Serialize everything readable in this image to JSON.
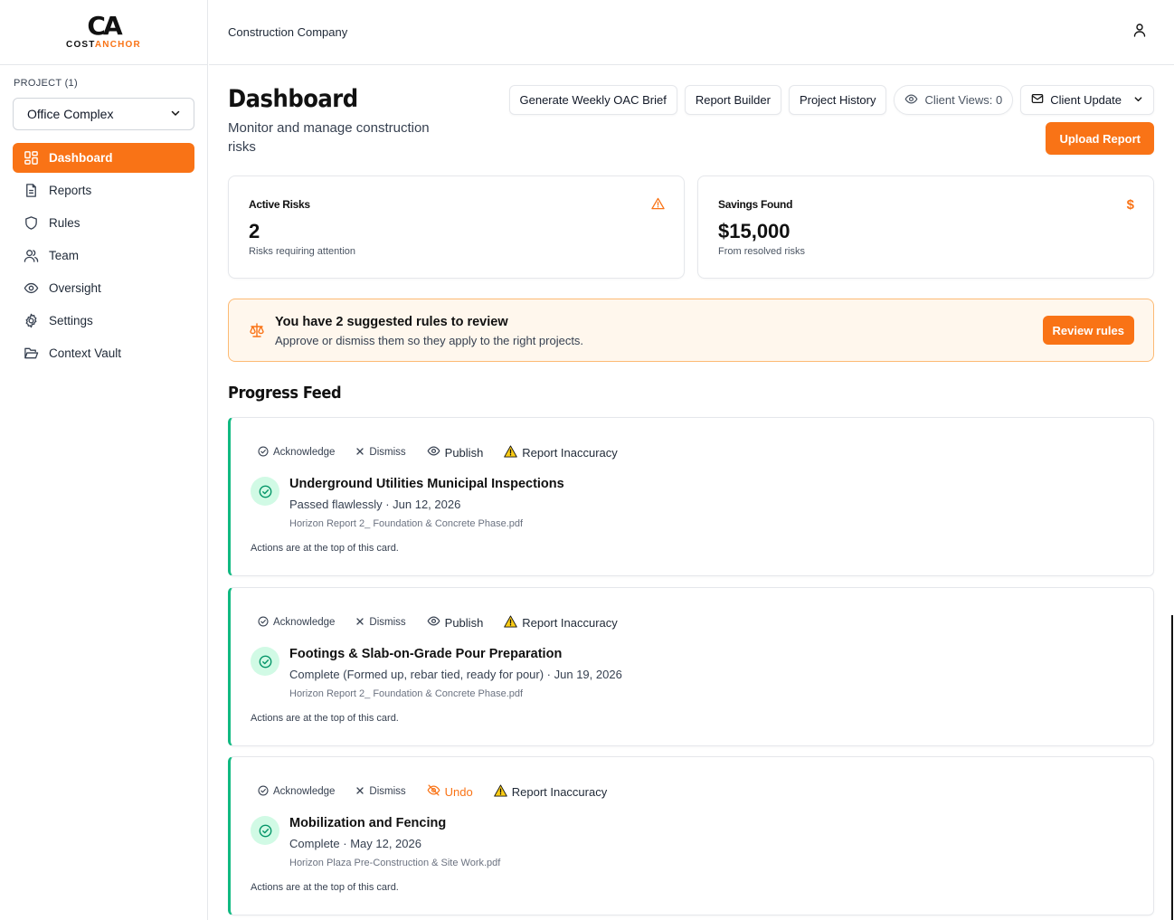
{
  "brand": {
    "mark": "CA",
    "name_part1": "COST",
    "name_part2": "ANCHOR"
  },
  "header": {
    "company": "Construction Company"
  },
  "sidebar": {
    "project_label": "PROJECT (1)",
    "project_selected": "Office Complex",
    "items": [
      {
        "label": "Dashboard",
        "icon": "layout-grid-icon",
        "active": true
      },
      {
        "label": "Reports",
        "icon": "file-text-icon"
      },
      {
        "label": "Rules",
        "icon": "shield-icon"
      },
      {
        "label": "Team",
        "icon": "users-icon"
      },
      {
        "label": "Oversight",
        "icon": "eye-icon"
      },
      {
        "label": "Settings",
        "icon": "gear-icon"
      },
      {
        "label": "Context Vault",
        "icon": "folder-open-icon"
      }
    ]
  },
  "page": {
    "title": "Dashboard",
    "subtitle": "Monitor and manage construction risks"
  },
  "toolbar": {
    "weekly_brief": "Generate Weekly OAC Brief",
    "report_builder": "Report Builder",
    "project_history": "Project History",
    "client_views": "Client Views: 0",
    "client_update": "Client Update",
    "upload_report": "Upload Report"
  },
  "stats": {
    "active_risks": {
      "label": "Active Risks",
      "value": "2",
      "desc": "Risks requiring attention"
    },
    "savings": {
      "label": "Savings Found",
      "value": "$15,000",
      "desc": "From resolved risks",
      "icon_char": "$"
    }
  },
  "banner": {
    "title": "You have 2 suggested rules to review",
    "desc": "Approve or dismiss them so they apply to the right projects.",
    "button": "Review rules"
  },
  "feed": {
    "title": "Progress Feed",
    "action_labels": {
      "acknowledge": "Acknowledge",
      "dismiss": "Dismiss",
      "publish": "Publish",
      "undo": "Undo",
      "report_inaccuracy": "Report Inaccuracy"
    },
    "footer": "Actions are at the top of this card.",
    "cards": [
      {
        "title": "Underground Utilities Municipal Inspections",
        "sub": "Passed flawlessly · Jun 12, 2026",
        "file": "Horizon Report 2_ Foundation & Concrete Phase.pdf",
        "published": false
      },
      {
        "title": "Footings & Slab-on-Grade Pour Preparation",
        "sub": "Complete (Formed up, rebar tied, ready for pour) · Jun 19, 2026",
        "file": "Horizon Report 2_ Foundation & Concrete Phase.pdf",
        "published": false
      },
      {
        "title": "Mobilization and Fencing",
        "sub": "Complete · May 12, 2026",
        "file": "Horizon Plaza Pre-Construction & Site Work.pdf",
        "published": true
      }
    ]
  },
  "colors": {
    "accent": "#f97316",
    "success": "#10b981",
    "success_bg": "#d1fae5",
    "banner_bg": "#fff7ed",
    "banner_border": "#fdba74"
  }
}
